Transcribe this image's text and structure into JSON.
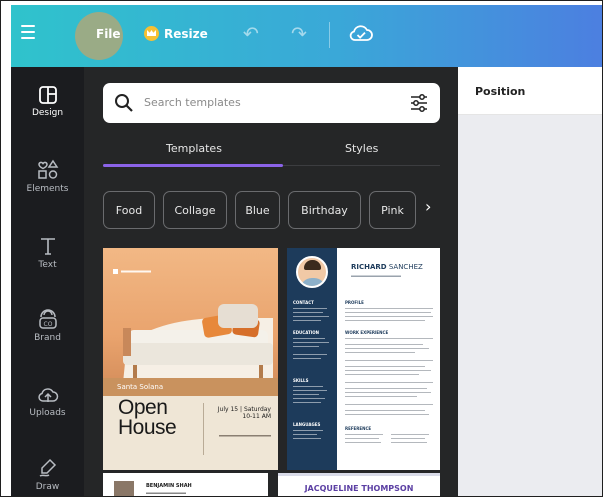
{
  "topbar": {
    "file_label": "File",
    "resize_label": "Resize"
  },
  "rail": {
    "items": [
      {
        "label": "Design",
        "icon": "design-icon"
      },
      {
        "label": "Elements",
        "icon": "elements-icon"
      },
      {
        "label": "Text",
        "icon": "text-icon"
      },
      {
        "label": "Brand",
        "icon": "brand-icon"
      },
      {
        "label": "Uploads",
        "icon": "uploads-icon"
      },
      {
        "label": "Draw",
        "icon": "draw-icon"
      }
    ]
  },
  "panel": {
    "search": {
      "placeholder": "Search templates"
    },
    "tabs": [
      {
        "label": "Templates",
        "active": true
      },
      {
        "label": "Styles",
        "active": false
      }
    ],
    "chips": [
      "Food",
      "Collage",
      "Blue",
      "Birthday",
      "Pink"
    ],
    "templates": {
      "open_house": {
        "label": "Santa Solana",
        "title_line1": "Open",
        "title_line2": "House",
        "date_line1": "July 15 | Saturday",
        "date_line2": "10-11 AM"
      },
      "resume": {
        "first_name": "RICHARD",
        "last_name": " SANCHEZ",
        "side_headings": [
          "CONTACT",
          "EDUCATION",
          "SKILLS",
          "LANGUAGES"
        ],
        "main_headings": [
          "PROFILE",
          "WORK EXPERIENCE",
          "REFERENCE"
        ]
      },
      "card3": {
        "name": "BENJAMIN SHAH"
      },
      "card4": {
        "name": "JACQUELINE THOMPSON"
      }
    }
  },
  "properties": {
    "title": "Position"
  },
  "colors": {
    "topbar_start": "#2fc3cc",
    "topbar_end": "#4c7fe0",
    "panel_bg": "#252627",
    "rail_bg": "#1b1c1f",
    "tab_underline": "#8b63e8",
    "canvas_bg": "#ebecf0"
  }
}
